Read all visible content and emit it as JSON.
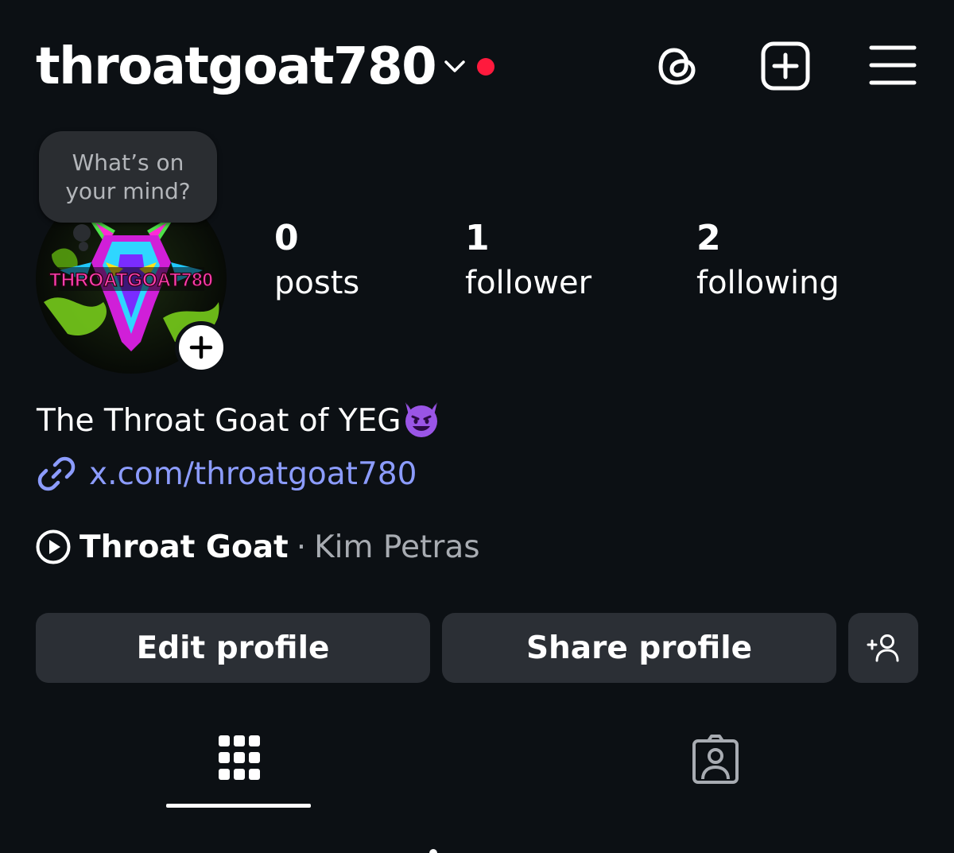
{
  "header": {
    "username": "throatgoat780",
    "notification_color": "#ff1a3d",
    "icons": [
      "threads-icon",
      "create-post-icon",
      "menu-icon"
    ]
  },
  "note": {
    "placeholder_line1": "What’s on",
    "placeholder_line2": "your mind?"
  },
  "avatar": {
    "logo_text": "THROATGOAT780",
    "add_icon": "plus-icon"
  },
  "stats": [
    {
      "count": "0",
      "label": "posts"
    },
    {
      "count": "1",
      "label": "follower"
    },
    {
      "count": "2",
      "label": "following"
    }
  ],
  "bio": {
    "text": "The Throat Goat of YEG",
    "emoji": "smiling-devil-emoji",
    "link": "x.com/throatgoat780",
    "link_color": "#8c9cff"
  },
  "music": {
    "song": "Throat Goat",
    "separator": "·",
    "artist": "Kim Petras"
  },
  "buttons": {
    "edit": "Edit profile",
    "share": "Share profile",
    "add_person_icon": "add-person-icon"
  },
  "tabs": [
    {
      "icon": "grid-icon",
      "active": true
    },
    {
      "icon": "tagged-icon",
      "active": false
    }
  ]
}
